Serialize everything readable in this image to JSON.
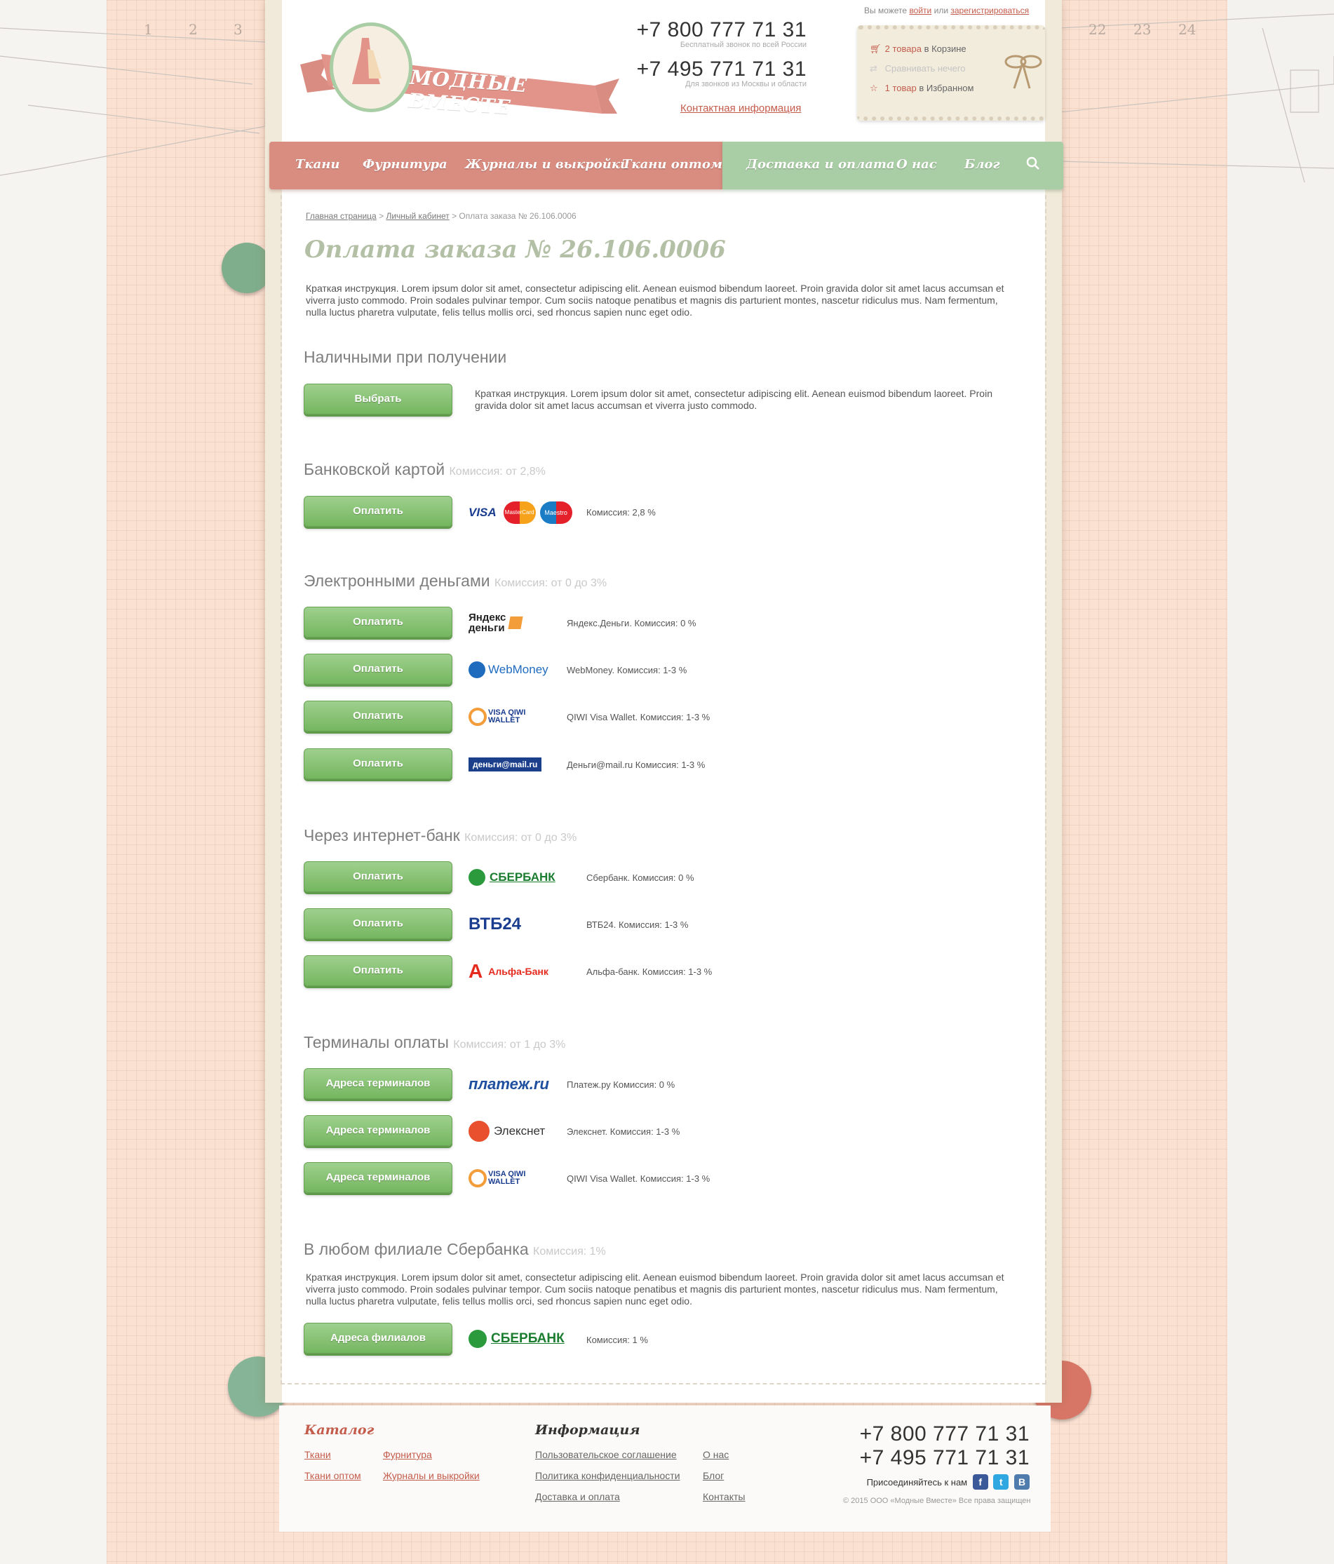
{
  "header": {
    "logo_text": "МОДНЫЕ ВМЕСТЕ",
    "phone1": "+7 800 777 71 31",
    "phone1_note": "Бесплатный звонок по всей России",
    "phone2": "+7 495 771 71 31",
    "phone2_note": "Для звонков из Москвы и области",
    "contact_link": "Контактная информация",
    "auth_prefix": "Вы можете",
    "auth_login": "войти",
    "auth_or": "или",
    "auth_register": "зарегистрироваться",
    "cart_count": "2 товара",
    "cart_suffix": "в Корзине",
    "compare": "Сравнивать нечего",
    "fav_count": "1 товар",
    "fav_suffix": "в Избранном"
  },
  "nav": {
    "left": [
      "Ткани",
      "Фурнитура",
      "Журналы и выкройки",
      "Ткани оптом"
    ],
    "right": [
      "Доставка и оплата",
      "О нас",
      "Блог"
    ]
  },
  "breadcrumb": {
    "home": "Главная страница",
    "sep": ">",
    "cabinet": "Личный кабинет",
    "current": "Оплата заказа № 26.106.0006"
  },
  "title": "Оплата заказа № 26.106.0006",
  "intro": "Краткая инструкция. Lorem ipsum dolor sit amet, consectetur adipiscing elit. Aenean euismod bibendum laoreet. Proin gravida dolor sit amet lacus accumsan et viverra justo commodo. Proin sodales pulvinar tempor. Cum sociis natoque penatibus et magnis dis parturient montes, nascetur ridiculus mus. Nam fermentum, nulla luctus pharetra vulputate, felis tellus mollis orci, sed rhoncus sapien nunc eget odio.",
  "sections": {
    "cash": {
      "title": "Наличными при получении",
      "button": "Выбрать",
      "desc": "Краткая инструкция. Lorem ipsum dolor sit amet, consectetur adipiscing elit. Aenean euismod bibendum laoreet. Proin gravida dolor sit amet lacus accumsan et viverra justo commodo."
    },
    "card": {
      "title": "Банковской картой",
      "commission": "Комиссия: от 2,8%",
      "button": "Оплатить",
      "logos": [
        "VISA",
        "MasterCard",
        "Maestro"
      ],
      "desc": "Комиссия: 2,8 %"
    },
    "emoney": {
      "title": "Электронными деньгами",
      "commission": "Комиссия: от 0 до 3%",
      "items": [
        {
          "button": "Оплатить",
          "logo": "Яндекс деньги",
          "desc": "Яндекс.Деньги. Комиссия: 0 %"
        },
        {
          "button": "Оплатить",
          "logo": "WebMoney",
          "desc": "WebMoney. Комиссия: 1-3 %"
        },
        {
          "button": "Оплатить",
          "logo": "VISA QIWI WALLET",
          "desc": "QIWI Visa Wallet. Комиссия: 1-3 %"
        },
        {
          "button": "Оплатить",
          "logo": "деньги@mail.ru",
          "desc": "Деньги@mail.ru Комиссия: 1-3 %"
        }
      ]
    },
    "ibank": {
      "title": "Через интернет-банк",
      "commission": "Комиссия: от 0 до 3%",
      "items": [
        {
          "button": "Оплатить",
          "logo": "СБЕРБАНК",
          "desc": "Сбербанк. Комиссия: 0 %"
        },
        {
          "button": "Оплатить",
          "logo": "ВТБ24",
          "desc": "ВТБ24. Комиссия: 1-3 %"
        },
        {
          "button": "Оплатить",
          "logo": "Альфа-Банк",
          "desc": "Альфа-банк. Комиссия: 1-3 %"
        }
      ]
    },
    "terminals": {
      "title": "Терминалы оплаты",
      "commission": "Комиссия: от 1 до 3%",
      "items": [
        {
          "button": "Адреса терминалов",
          "logo": "платеж.ru",
          "desc": "Платеж.ру Комиссия: 0 %"
        },
        {
          "button": "Адреса терминалов",
          "logo": "Элекснет",
          "desc": "Элекснет. Комиссия: 1-3 %"
        },
        {
          "button": "Адреса терминалов",
          "logo": "VISA QIWI WALLET",
          "desc": "QIWI Visa Wallet. Комиссия: 1-3 %"
        }
      ]
    },
    "sber_branch": {
      "title": "В любом филиале Сбербанка",
      "commission": "Комиссия: 1%",
      "text": "Краткая инструкция. Lorem ipsum dolor sit amet, consectetur adipiscing elit. Aenean euismod bibendum laoreet. Proin gravida dolor sit amet lacus accumsan et viverra justo commodo. Proin sodales pulvinar tempor. Cum sociis natoque penatibus et magnis dis parturient montes, nascetur ridiculus mus. Nam fermentum, nulla luctus pharetra vulputate, felis tellus mollis orci, sed rhoncus sapien nunc eget odio.",
      "button": "Адреса филиалов",
      "logo": "СБЕРБАНК",
      "desc": "Комиссия: 1 %"
    }
  },
  "footer": {
    "catalog_title": "Каталог",
    "catalog_links": [
      "Ткани",
      "Фурнитура",
      "Ткани оптом",
      "Журналы и выкройки"
    ],
    "info_title": "Информация",
    "info_links": [
      "Пользовательское соглашение",
      "О нас",
      "Политика конфиденциальности",
      "Блог",
      "Доставка и оплата",
      "Контакты"
    ],
    "phone1": "+7 800 777 71 31",
    "phone2": "+7 495 771 71 31",
    "join": "Присоединяйтесь к нам",
    "copyright": "© 2015 ООО «Модные Вместе» Все права защищен"
  },
  "colors": {
    "accent_red": "#c45c4c",
    "nav_red": "#d98c80",
    "nav_green": "#a9cda4",
    "button_green": "#74b65f",
    "title_green": "#b3c0a6"
  },
  "ruler": {
    "left": [
      "1",
      "2",
      "3"
    ],
    "right": [
      "22",
      "23",
      "24"
    ]
  }
}
